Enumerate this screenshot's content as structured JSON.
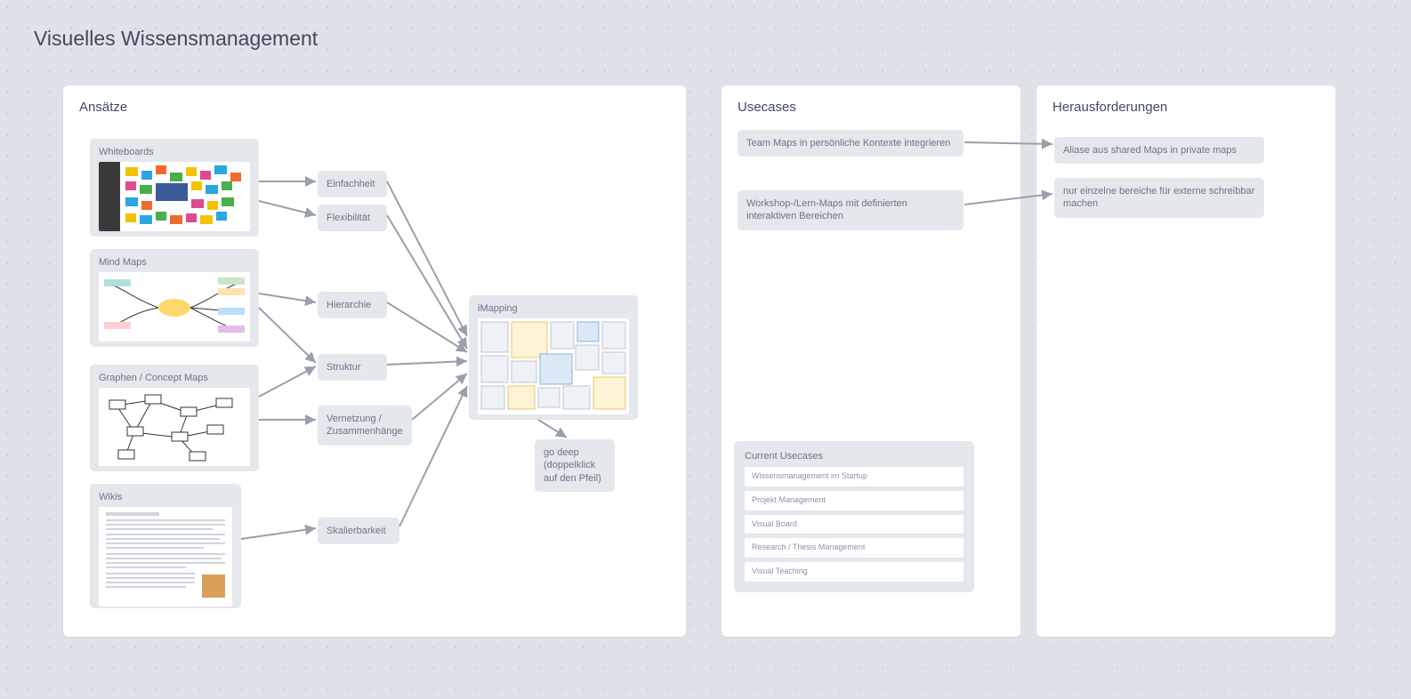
{
  "title": "Visuelles Wissensmanagement",
  "panels": {
    "ansatze": {
      "title": "Ansätze"
    },
    "usecases": {
      "title": "Usecases"
    },
    "heraus": {
      "title": "Herausforderungen"
    }
  },
  "approaches": {
    "whiteboards": "Whiteboards",
    "mindmaps": "Mind Maps",
    "graphen": "Graphen / Concept Maps",
    "wikis": "Wikis"
  },
  "props": {
    "einfachheit": "Einfachheit",
    "flex": "Flexibilität",
    "hier": "Hierarchie",
    "struktur": "Struktur",
    "vernetz": "Vernetzung / Zusammenhänge",
    "skal": "Skalierbarkeit"
  },
  "imapping": {
    "label": "iMapping",
    "hint": "go deep\n(doppelklick\nauf den Pfeil)"
  },
  "usecase_nodes": {
    "team": "Team Maps in persönliche Kontexte integrieren",
    "workshop": "Workshop-/Lern-Maps mit definierten interaktiven Bereichen"
  },
  "heraus_nodes": {
    "aliase": "Aliase aus shared Maps in private maps",
    "bereiche": "nur einzelne bereiche für externe schreibbar machen"
  },
  "current": {
    "title": "Current Usecases",
    "items": [
      "Wissensmanagement im Startup",
      "Projekt Management",
      "Visual Board",
      "Research / Thesis Management",
      "Visual Teaching"
    ]
  }
}
